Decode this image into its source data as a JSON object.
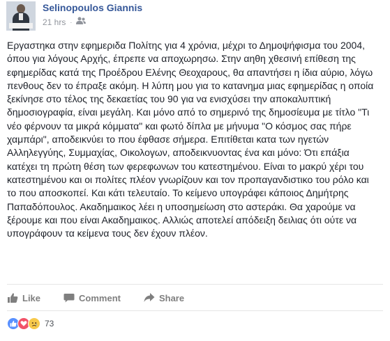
{
  "post": {
    "author": "Selinopoulos Giannis",
    "timestamp": "21 hrs",
    "separator": "·",
    "audience_icon": "friends-icon",
    "text": "Εργαστηκα στην εφημεριδα Πολίτης για 4 χρόνια, μέχρι το Δημοψήφισμα του 2004, όπου για λόγους Αρχής, έπρεπε να αποχωρησω. Στην αηθη χθεσινή επίθεση της εφημερίδας κατά της Προέδρου Ελένης Θεοχαρους, θα απαντήσει η ίδια αύριο, λόγω πενθους δεν το έπραξε ακόμη. Η λύπη μου για το κατανημα μιας εφημερίδας η οποία ξεκίνησε στο τέλος της δεκαετίας του 90 για να ενισχύσει την αποκαλυπτική δημοσιογραφία, είναι μεγάλη. Και μόνο από το σημερινό της δημοσίευμα με τίτλο \"Τι νέο φέρνουν τα μικρά κόμματα\" και φωτό δίπλα με μήνυμα \"Ο κόσμος σας πήρε χαμπάρι\", αποδεικνύει το που έφθασε σήμερα. Επιτίθεται κατα των ηγετών Αλληλεγγύης, Συμμαχίας, Οικολογων, αποδεικνυοντας ένα και μόνο: Ότι επάξια κατέχει τη πρώτη θέση των φερεφωνων του κατεστημένου. Είναι το μακρύ χέρι του κατεστημένου και οι πολίτες πλέον γνωρίζουν και τον προπαγανδιστικο του ρόλο και το που αποσκοπεί. Και κάτι τελευταίο. Το κείμενο υπογράφει κάποιος Δημήτρης Παπαδόπουλος. Ακαδημαικος λέει η υποσημείωση στο αστεράκι. Θα χαρούμε να ξέρουμε και που είναι Ακαδημαικος. Αλλιώς αποτελεί απόδειξη δειλιας ότι ούτε να υπογράφουν τα κείμενα τους δεν έχουν πλέον."
  },
  "actions": {
    "like": "Like",
    "comment": "Comment",
    "share": "Share"
  },
  "reactions": {
    "types": [
      "like",
      "love",
      "sad"
    ],
    "count": "73"
  },
  "colors": {
    "author": "#365899",
    "meta": "#90949c",
    "action": "#7f7f7f",
    "like": "#5890ff",
    "love": "#f25268",
    "sad": "#f7c94a"
  }
}
